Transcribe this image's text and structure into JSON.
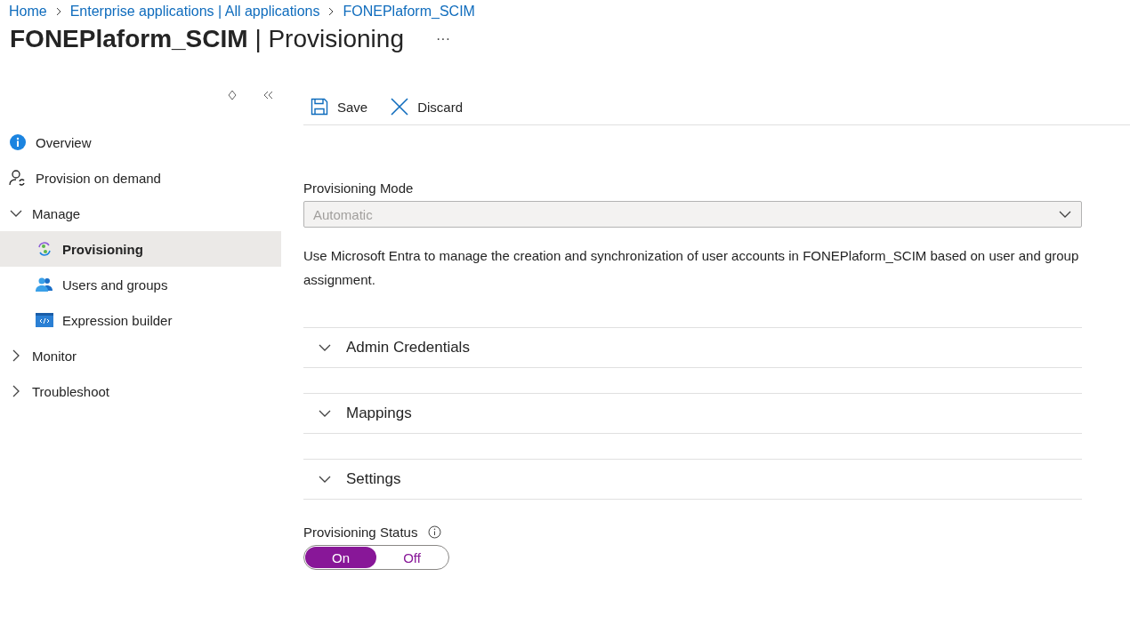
{
  "breadcrumb": [
    "Home",
    "Enterprise applications | All applications",
    "FONEPlaform_SCIM"
  ],
  "page_title": "**FONEPlaform_SCIM** | Provisioning",
  "more_label": "···",
  "sidebar": {
    "items": [
      {
        "label": "Overview",
        "selected": false
      },
      {
        "label": "Provision on demand",
        "selected": false
      },
      {
        "label": "Manage",
        "expanded": true,
        "children": [
          {
            "label": "Provisioning",
            "selected": true
          },
          {
            "label": "Users and groups",
            "selected": false
          },
          {
            "label": "Expression builder",
            "selected": false
          }
        ]
      },
      {
        "label": "Monitor",
        "expanded": false
      },
      {
        "label": "Troubleshoot",
        "expanded": false
      }
    ]
  },
  "toolbar": [
    {
      "label": "Save"
    },
    {
      "label": "Discard"
    }
  ],
  "provisioning_mode": {
    "label": "Provisioning Mode",
    "value": "Automatic",
    "disabled": true
  },
  "description": "Use Microsoft Entra to manage the creation and synchronization of user accounts in FONEPlaform_SCIM based on user and group assignment.",
  "sections": [
    {
      "title": "Admin Credentials",
      "expanded": false
    },
    {
      "title": "Mappings",
      "expanded": false
    },
    {
      "title": "Settings",
      "expanded": false
    }
  ],
  "provisioning_status": {
    "label": "Provisioning Status",
    "options": [
      {
        "label": "On",
        "selected": true
      },
      {
        "label": "Off",
        "selected": false
      }
    ]
  }
}
